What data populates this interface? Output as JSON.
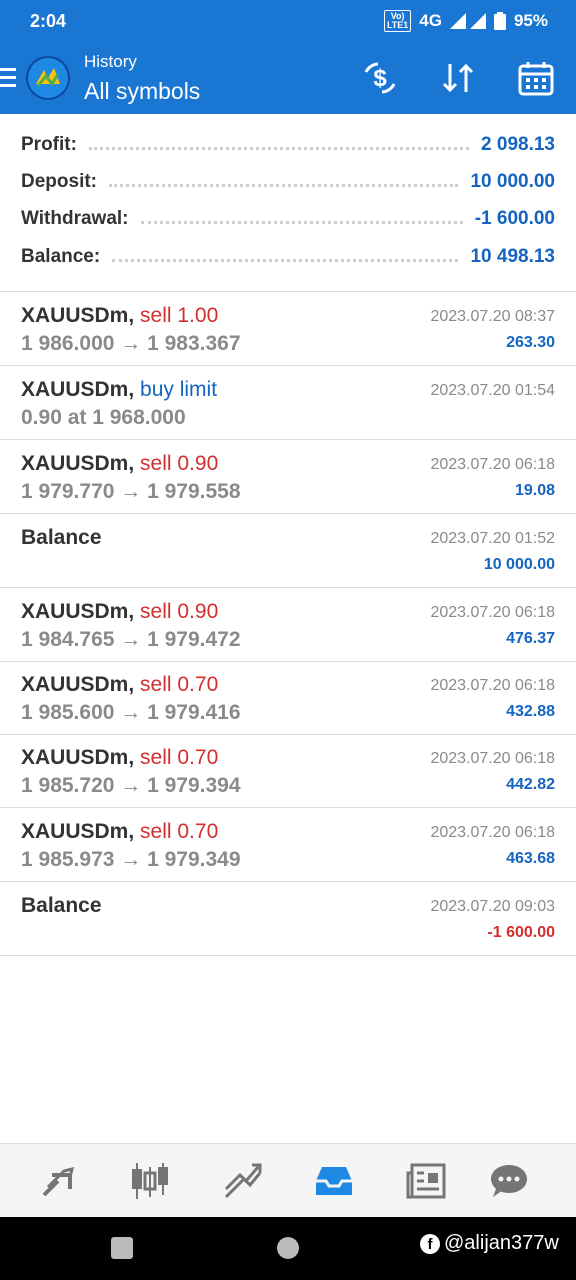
{
  "status_bar": {
    "time": "2:04",
    "network": "4G",
    "volte": "Vo) LTE1",
    "battery": "95%"
  },
  "app_bar": {
    "subtitle": "History",
    "title": "All symbols"
  },
  "summary": [
    {
      "label": "Profit:",
      "value": "2 098.13"
    },
    {
      "label": "Deposit:",
      "value": "10 000.00"
    },
    {
      "label": "Withdrawal:",
      "value": "-1 600.00"
    },
    {
      "label": "Balance:",
      "value": "10 498.13"
    }
  ],
  "deals": [
    {
      "symbol": "XAUUSDm,",
      "action": "sell 1.00",
      "action_type": "sell",
      "prices": "1 986.000 → 1 983.367",
      "time": "2023.07.20 08:37",
      "profit": "263.30"
    },
    {
      "symbol": "XAUUSDm,",
      "action": "buy limit",
      "action_type": "buy",
      "prices": "0.90 at 1 968.000",
      "time": "2023.07.20 01:54",
      "profit": ""
    },
    {
      "symbol": "XAUUSDm,",
      "action": "sell 0.90",
      "action_type": "sell",
      "prices": "1 979.770 → 1 979.558",
      "time": "2023.07.20 06:18",
      "profit": "19.08"
    },
    {
      "symbol": "Balance",
      "action": "",
      "action_type": "balance",
      "prices": "",
      "time": "2023.07.20 01:52",
      "profit": "10 000.00"
    },
    {
      "symbol": "XAUUSDm,",
      "action": "sell 0.90",
      "action_type": "sell",
      "prices": "1 984.765 → 1 979.472",
      "time": "2023.07.20 06:18",
      "profit": "476.37"
    },
    {
      "symbol": "XAUUSDm,",
      "action": "sell 0.70",
      "action_type": "sell",
      "prices": "1 985.600 → 1 979.416",
      "time": "2023.07.20 06:18",
      "profit": "432.88"
    },
    {
      "symbol": "XAUUSDm,",
      "action": "sell 0.70",
      "action_type": "sell",
      "prices": "1 985.720 → 1 979.394",
      "time": "2023.07.20 06:18",
      "profit": "442.82"
    },
    {
      "symbol": "XAUUSDm,",
      "action": "sell 0.70",
      "action_type": "sell",
      "prices": "1 985.973 → 1 979.349",
      "time": "2023.07.20 06:18",
      "profit": "463.68"
    },
    {
      "symbol": "Balance",
      "action": "",
      "action_type": "balance",
      "prices": "",
      "time": "2023.07.20 09:03",
      "profit": "-1 600.00",
      "negative": true
    }
  ],
  "bottom_nav": [
    {
      "name": "quotes",
      "icon": "quotes-icon"
    },
    {
      "name": "chart",
      "icon": "candlestick-icon"
    },
    {
      "name": "trade",
      "icon": "trade-icon"
    },
    {
      "name": "history",
      "icon": "history-inbox-icon",
      "active": true
    },
    {
      "name": "news",
      "icon": "news-icon"
    },
    {
      "name": "chat",
      "icon": "chat-icon"
    }
  ],
  "watermark": "@alijan377w",
  "colors": {
    "primary": "#1976d2",
    "profit": "#1565c0",
    "loss": "#d32f2f",
    "muted": "#8a8a8a"
  }
}
